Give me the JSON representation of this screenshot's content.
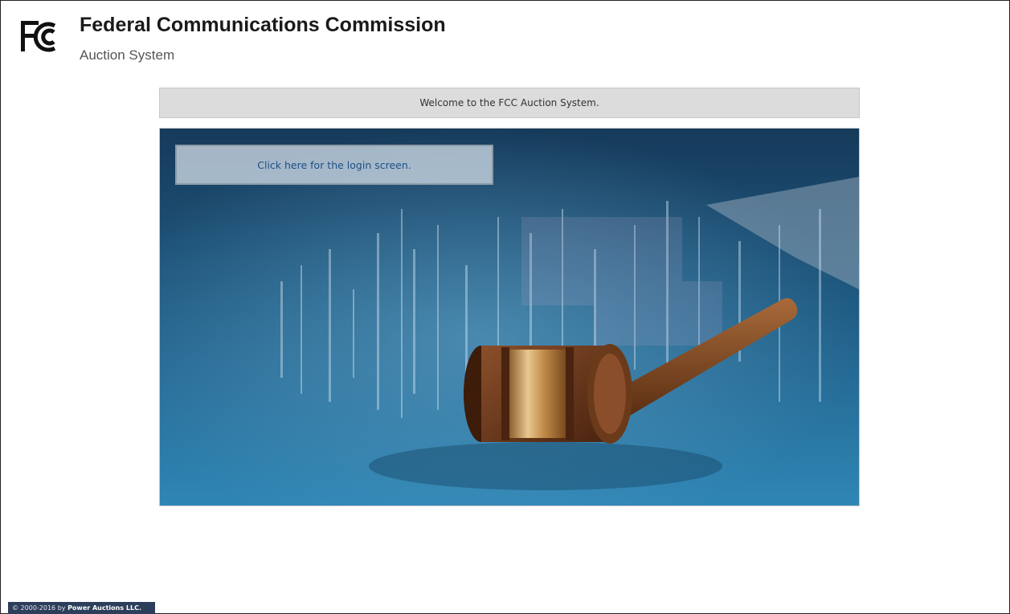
{
  "header": {
    "logo_text": "FC",
    "title": "Federal Communications Commission",
    "subtitle": "Auction System"
  },
  "welcome": {
    "message": "Welcome to the FCC Auction System."
  },
  "hero": {
    "login_link_label": "Click here for the login screen.",
    "image_subject": "gavel"
  },
  "footer": {
    "prefix": "© 2000-2016 by",
    "company": "Power Auctions LLC."
  },
  "colors": {
    "link": "#1d4f86",
    "welcome_bar": "#dcdcdc",
    "footer_bg": "#2c3e5a",
    "hero_blue": "#2a6f9a"
  }
}
